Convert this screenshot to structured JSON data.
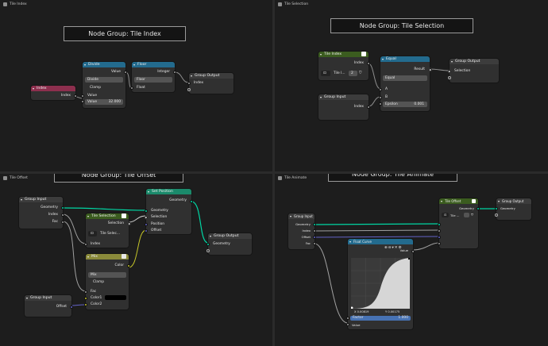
{
  "colors": {
    "group": "#3c3c3c",
    "math": "#236b8e",
    "output": "#3c3c3c",
    "index": "#8d2f4e",
    "setpos": "#1b8a6b",
    "mix": "#8a8a3a",
    "nodegroup": "#3b5c1f",
    "curve": "#3c3c3c"
  },
  "panels": [
    {
      "title": "Tile Index",
      "frame": "Node Group: Tile Index"
    },
    {
      "title": "Tile Selection",
      "frame": "Node Group: Tile Selection"
    },
    {
      "title": "Tile Offset",
      "frame": "Node Group: Tile Offset"
    },
    {
      "title": "Tile Animate",
      "frame": "Node Group: Tile Animate"
    }
  ],
  "p1": {
    "index": {
      "title": "Index",
      "out": "Index"
    },
    "divide": {
      "title": "Divide",
      "value_out": "Value",
      "mode": "Divide",
      "clamp": "Clamp",
      "value_in": "Value",
      "num_label": "Value",
      "num": "32.000"
    },
    "floor": {
      "title": "Floor",
      "integer": "Integer",
      "mode": "Floor",
      "float": "Float"
    },
    "out": {
      "title": "Group Output",
      "index": "Index"
    }
  },
  "p2": {
    "tileindex": {
      "title": "Tile Index",
      "index": "Index",
      "name": "Tile I...",
      "num": "2"
    },
    "group_input": {
      "title": "Group Input",
      "index": "Index"
    },
    "equal": {
      "title": "Equal",
      "result": "Result",
      "mode": "Equal",
      "a": "A",
      "b": "B",
      "eps_label": "Epsilon",
      "eps": "0.001"
    },
    "out": {
      "title": "Group Output",
      "selection": "Selection"
    }
  },
  "p3": {
    "gi1": {
      "title": "Group Input",
      "geometry": "Geometry",
      "index": "Index",
      "fac": "Fac"
    },
    "tilesel": {
      "title": "Tile Selection",
      "selection": "Selection",
      "name": "Tile Selec...",
      "index": "Index"
    },
    "setpos": {
      "title": "Set Position",
      "geometry_out": "Geometry",
      "geometry": "Geometry",
      "selection": "Selection",
      "position": "Position",
      "offset": "Offset"
    },
    "out": {
      "title": "Group Output",
      "geometry": "Geometry"
    },
    "mix": {
      "title": "Mix",
      "color_out": "Color",
      "mode": "Mix",
      "clamp": "Clamp",
      "fac": "Fac",
      "c1": "Color1",
      "c2": "Color2"
    },
    "gi2": {
      "title": "Group Input",
      "offset": "Offset"
    }
  },
  "p4": {
    "gi": {
      "title": "Group Input",
      "geometry": "Geometry",
      "index": "Index",
      "offset": "Offset",
      "fac": "Fac"
    },
    "tileoffset": {
      "title": "Tile Offset",
      "geometry": "Geometry",
      "name": "Tile ..."
    },
    "out": {
      "title": "Group Output",
      "geometry": "Geometry"
    },
    "curve": {
      "title": "Float Curve",
      "value_out": "Value",
      "x": "X 0.00819",
      "y": "Y 0.00175",
      "factor_label": "Factor",
      "factor": "1.000",
      "value_in": "Value"
    }
  }
}
